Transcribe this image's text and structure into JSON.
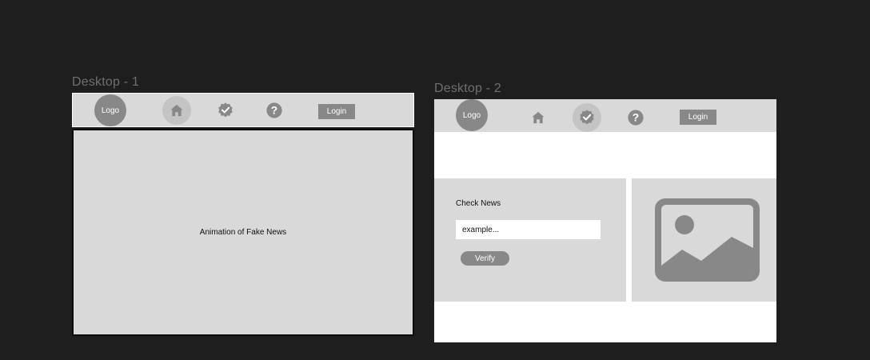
{
  "canvas": {
    "background": "#1e1e1e"
  },
  "desktop1": {
    "label": "Desktop - 1",
    "nav": {
      "logo": "Logo",
      "icons": [
        "home-icon",
        "verified-badge-icon",
        "help-icon"
      ],
      "active_icon": "home-icon",
      "login": "Login"
    },
    "animation_text": "Animation of Fake News"
  },
  "desktop2": {
    "label": "Desktop - 2",
    "nav": {
      "logo": "Logo",
      "icons": [
        "home-icon",
        "verified-badge-icon",
        "help-icon"
      ],
      "active_icon": "verified-badge-icon",
      "login": "Login"
    },
    "check_news": {
      "title": "Check News",
      "input_value": "",
      "input_placeholder": "example...",
      "button": "Verify"
    },
    "image_icon": "image-placeholder-icon"
  },
  "colors": {
    "panel_gray": "#d9d9d9",
    "mid_gray": "#888888",
    "active_circle": "#c4c4c4",
    "frame_white": "#ffffff",
    "label_gray": "#6f6f6f"
  }
}
